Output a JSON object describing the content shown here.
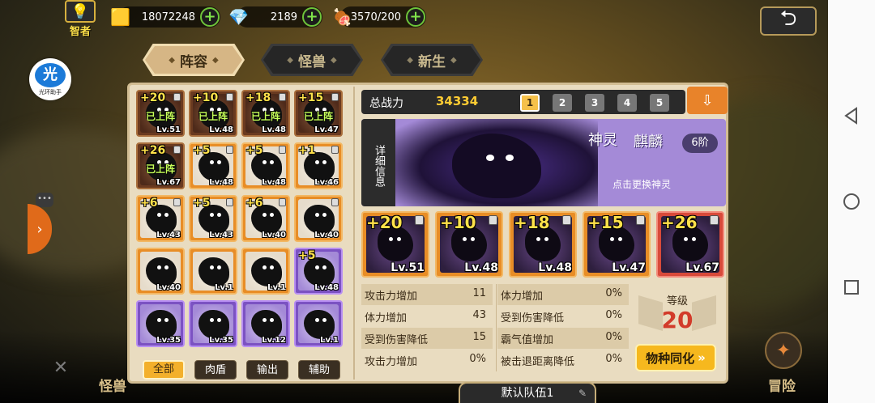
{
  "topbar": {
    "avatar_title": "智者",
    "gold": "18072248",
    "gems": "2189",
    "stamina": "3570/200",
    "plus": "+"
  },
  "helper": {
    "char": "光",
    "label": "光环助手"
  },
  "tabs": [
    {
      "label": "阵容",
      "active": true
    },
    {
      "label": "怪兽",
      "active": false
    },
    {
      "label": "新生",
      "active": false
    }
  ],
  "grid": [
    {
      "plus": "+20",
      "lv": "Lv.51",
      "status": "已上阵",
      "frame": "brown",
      "lock": true
    },
    {
      "plus": "+10",
      "lv": "Lv.48",
      "status": "已上阵",
      "frame": "brown",
      "lock": true
    },
    {
      "plus": "+18",
      "lv": "Lv.48",
      "status": "已上阵",
      "frame": "brown",
      "lock": true
    },
    {
      "plus": "+15",
      "lv": "Lv.47",
      "status": "已上阵",
      "frame": "brown",
      "lock": true
    },
    {
      "plus": "+26",
      "lv": "Lv.67",
      "status": "已上阵",
      "frame": "brown",
      "lock": true
    },
    {
      "plus": "+5",
      "lv": "Lv.48",
      "status": "",
      "frame": "orange",
      "lock": true
    },
    {
      "plus": "+5",
      "lv": "Lv.48",
      "status": "",
      "frame": "orange",
      "lock": true
    },
    {
      "plus": "+1",
      "lv": "Lv.46",
      "status": "",
      "frame": "orange",
      "lock": true
    },
    {
      "plus": "+6",
      "lv": "Lv.43",
      "status": "",
      "frame": "orange",
      "lock": true
    },
    {
      "plus": "+5",
      "lv": "Lv.43",
      "status": "",
      "frame": "orange",
      "lock": true
    },
    {
      "plus": "+6",
      "lv": "Lv.40",
      "status": "",
      "frame": "orange",
      "lock": true
    },
    {
      "plus": "",
      "lv": "Lv.40",
      "status": "",
      "frame": "orange",
      "lock": true
    },
    {
      "plus": "",
      "lv": "Lv.40",
      "status": "",
      "frame": "orange",
      "lock": false
    },
    {
      "plus": "",
      "lv": "Lv.1",
      "status": "",
      "frame": "orange",
      "lock": false
    },
    {
      "plus": "",
      "lv": "Lv.1",
      "status": "",
      "frame": "orange",
      "lock": false
    },
    {
      "plus": "+5",
      "lv": "Lv.48",
      "status": "",
      "frame": "purple",
      "lock": false
    },
    {
      "plus": "",
      "lv": "Lv.35",
      "status": "",
      "frame": "purple",
      "lock": false
    },
    {
      "plus": "",
      "lv": "Lv.35",
      "status": "",
      "frame": "purple",
      "lock": false
    },
    {
      "plus": "",
      "lv": "Lv.12",
      "status": "",
      "frame": "purple",
      "lock": false
    },
    {
      "plus": "",
      "lv": "Lv.1",
      "status": "",
      "frame": "purple",
      "lock": false
    }
  ],
  "filters": [
    {
      "label": "全部",
      "active": true
    },
    {
      "label": "肉盾",
      "active": false
    },
    {
      "label": "输出",
      "active": false
    },
    {
      "label": "辅助",
      "active": false
    }
  ],
  "power": {
    "label": "总战力",
    "value": "34334"
  },
  "team_numbers": [
    "1",
    "2",
    "3",
    "4",
    "5"
  ],
  "active_team": "1",
  "banner": {
    "side_label": "详细信息",
    "title_a": "神灵",
    "title_b": "麒麟",
    "rank": "6阶",
    "hint": "点击更换神灵"
  },
  "team": [
    {
      "plus": "+20",
      "lv": "Lv.51"
    },
    {
      "plus": "+10",
      "lv": "Lv.48"
    },
    {
      "plus": "+18",
      "lv": "Lv.48"
    },
    {
      "plus": "+15",
      "lv": "Lv.47"
    },
    {
      "plus": "+26",
      "lv": "Lv.67"
    }
  ],
  "stats_left": [
    {
      "name": "攻击力增加",
      "value": "11"
    },
    {
      "name": "体力增加",
      "value": "43"
    },
    {
      "name": "受到伤害降低",
      "value": "15"
    },
    {
      "name": "攻击力增加",
      "value": "0%"
    }
  ],
  "stats_right": [
    {
      "name": "体力增加",
      "value": "0%"
    },
    {
      "name": "受到伤害降低",
      "value": "0%"
    },
    {
      "name": "霸气值增加",
      "value": "0%"
    },
    {
      "name": "被击退距离降低",
      "value": "0%"
    }
  ],
  "level": {
    "label": "等级",
    "value": "20"
  },
  "sync_button": "物种同化",
  "team_name": "默认队伍1",
  "bottom_nav": {
    "left": "怪兽",
    "right": "冒险"
  },
  "colors": {
    "accent": "#f6b81e",
    "power": "#ffcc33",
    "deployed": "#c6ff5a",
    "level": "#d23b2a"
  }
}
